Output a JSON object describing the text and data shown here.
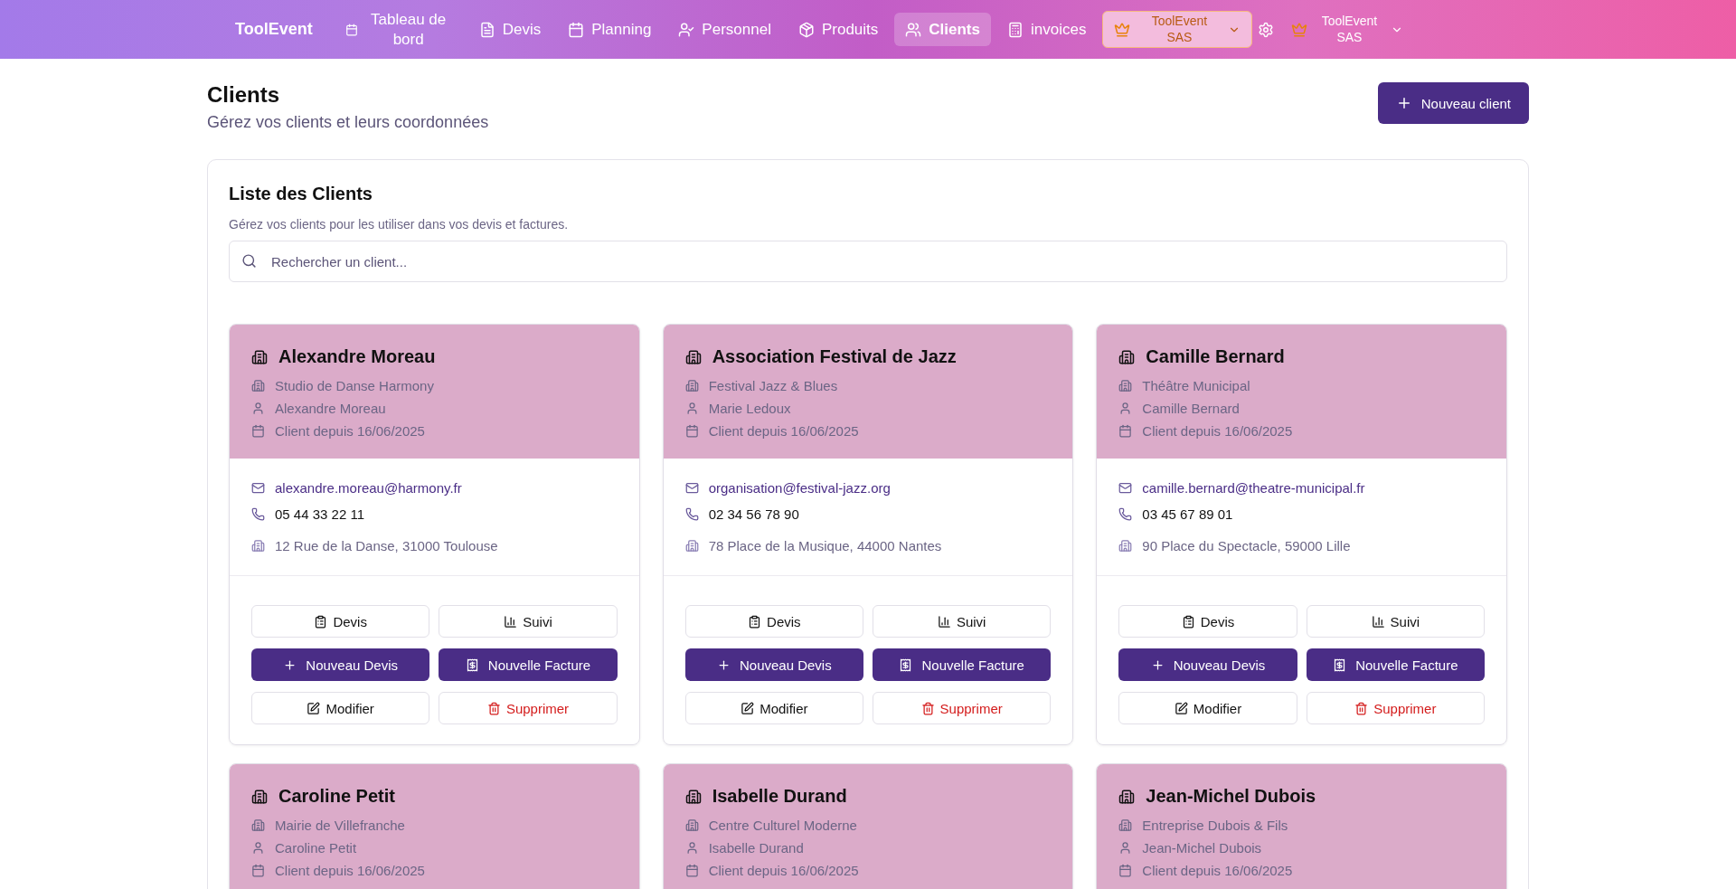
{
  "navbar": {
    "brand": "ToolEvent",
    "items": [
      {
        "label": "Tableau de bord",
        "selected": false
      },
      {
        "label": "Devis",
        "selected": false
      },
      {
        "label": "Planning",
        "selected": false
      },
      {
        "label": "Personnel",
        "selected": false
      },
      {
        "label": "Produits",
        "selected": false
      },
      {
        "label": "Clients",
        "selected": true
      },
      {
        "label": "invoices",
        "selected": false
      }
    ],
    "org_selectors": [
      {
        "label": "ToolEvent SAS",
        "selected": true
      },
      {
        "label": "ToolEvent SAS",
        "selected": false
      }
    ]
  },
  "header": {
    "title": "Clients",
    "subtitle": "Gérez vos clients et leurs coordonnées",
    "new_button": "Nouveau client"
  },
  "panel": {
    "title": "Liste des Clients",
    "description": "Gérez vos clients pour les utiliser dans vos devis et factures.",
    "search": {
      "placeholder": "Rechercher un client..."
    }
  },
  "clients": [
    {
      "name": "Alexandre Moreau",
      "company": "Studio de Danse Harmony",
      "contact": "Alexandre Moreau",
      "since": "Client depuis 16/06/2025",
      "email": "alexandre.moreau@harmony.fr",
      "phone": "05 44 33 22 11",
      "address": "12 Rue de la Danse, 31000 Toulouse",
      "actions": [
        "Devis",
        "Suivi",
        "Nouveau Devis",
        "Nouvelle Facture",
        "Modifier",
        "Supprimer"
      ]
    },
    {
      "name": "Association Festival de Jazz",
      "company": "Festival Jazz & Blues",
      "contact": "Marie Ledoux",
      "since": "Client depuis 16/06/2025",
      "email": "organisation@festival-jazz.org",
      "phone": "02 34 56 78 90",
      "address": "78 Place de la Musique, 44000 Nantes",
      "actions": [
        "Devis",
        "Suivi",
        "Nouveau Devis",
        "Nouvelle Facture",
        "Modifier",
        "Supprimer"
      ]
    },
    {
      "name": "Camille Bernard",
      "company": "Théâtre Municipal",
      "contact": "Camille Bernard",
      "since": "Client depuis 16/06/2025",
      "email": "camille.bernard@theatre-municipal.fr",
      "phone": "03 45 67 89 01",
      "address": "90 Place du Spectacle, 59000 Lille",
      "actions": [
        "Devis",
        "Suivi",
        "Nouveau Devis",
        "Nouvelle Facture",
        "Modifier",
        "Supprimer"
      ]
    },
    {
      "name": "Caroline Petit",
      "company": "Mairie de Villefranche",
      "contact": "Caroline Petit",
      "since": "Client depuis 16/06/2025"
    },
    {
      "name": "Isabelle Durand",
      "company": "Centre Culturel Moderne",
      "contact": "Isabelle Durand",
      "since": "Client depuis 16/06/2025"
    },
    {
      "name": "Jean-Michel Dubois",
      "company": "Entreprise Dubois & Fils",
      "contact": "Jean-Michel Dubois",
      "since": "Client depuis 16/06/2025"
    }
  ]
}
